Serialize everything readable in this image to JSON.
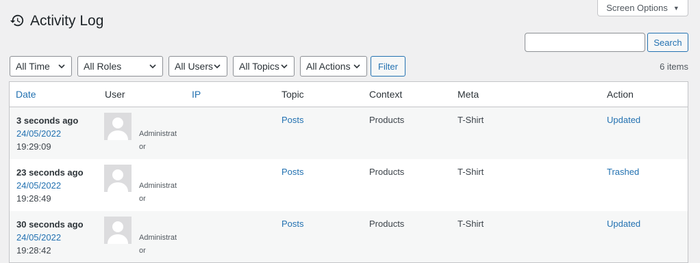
{
  "header": {
    "screen_options_label": "Screen Options",
    "page_title": "Activity Log",
    "search": {
      "value": "",
      "placeholder": ""
    },
    "search_button": "Search"
  },
  "filters": {
    "time": "All Time",
    "roles": "All Roles",
    "users": "All Users",
    "topics": "All Topics",
    "actions": "All Actions",
    "filter_button": "Filter"
  },
  "items_count": "6 items",
  "table": {
    "columns": {
      "date": "Date",
      "user": "User",
      "ip": "IP",
      "topic": "Topic",
      "context": "Context",
      "meta": "Meta",
      "action": "Action"
    },
    "rows": [
      {
        "ago": "3 seconds ago",
        "date": "24/05/2022",
        "time": "19:29:09",
        "role": "Administrator",
        "topic": "Posts",
        "context": "Products",
        "meta": "T-Shirt",
        "action": "Updated"
      },
      {
        "ago": "23 seconds ago",
        "date": "24/05/2022",
        "time": "19:28:49",
        "role": "Administrator",
        "topic": "Posts",
        "context": "Products",
        "meta": "T-Shirt",
        "action": "Trashed"
      },
      {
        "ago": "30 seconds ago",
        "date": "24/05/2022",
        "time": "19:28:42",
        "role": "Administrator",
        "topic": "Posts",
        "context": "Products",
        "meta": "T-Shirt",
        "action": "Updated"
      }
    ]
  },
  "colors": {
    "accent": "#2271b1",
    "background": "#f0f0f1",
    "row_alt": "#f6f7f7"
  }
}
